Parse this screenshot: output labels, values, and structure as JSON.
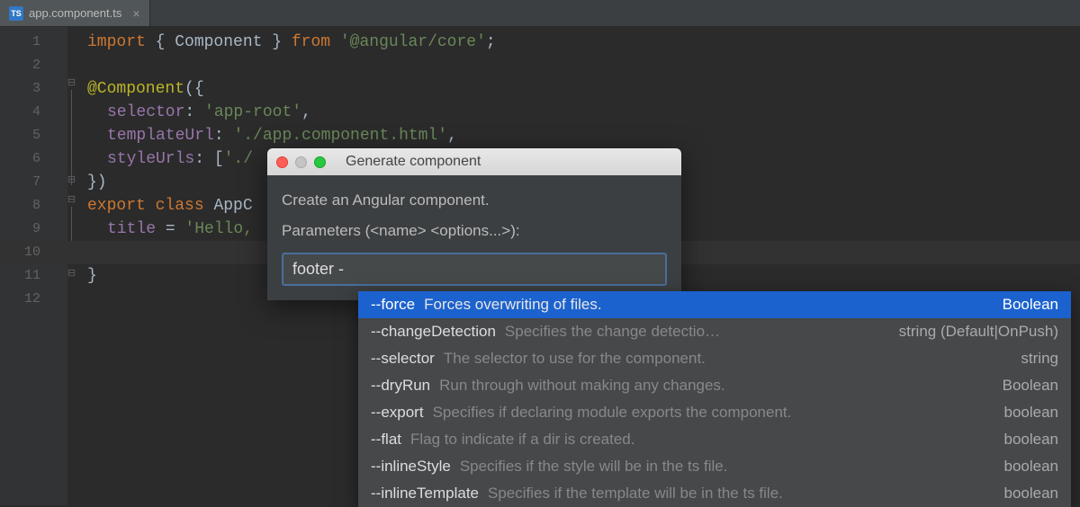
{
  "tab": {
    "file_icon_label": "TS",
    "filename": "app.component.ts",
    "close_glyph": "×"
  },
  "gutter": {
    "line_numbers": [
      "1",
      "2",
      "3",
      "4",
      "5",
      "6",
      "7",
      "8",
      "9",
      "10",
      "11",
      "12"
    ]
  },
  "code": {
    "l1_import": "import",
    "l1_braces_open": " { ",
    "l1_component": "Component",
    "l1_braces_close": " } ",
    "l1_from": "from",
    "l1_pkg": " '@angular/core'",
    "l1_semi": ";",
    "l3_decorator": "@Component",
    "l3_open": "({",
    "l4_key": "selector",
    "l4_colon": ": ",
    "l4_val": "'app-root'",
    "l4_comma": ",",
    "l5_key": "templateUrl",
    "l5_colon": ": ",
    "l5_val": "'./app.component.html'",
    "l5_comma": ",",
    "l6_key": "styleUrls",
    "l6_colon": ": [",
    "l6_val": "'./",
    "l7_close": "})",
    "l8_export": "export",
    "l8_class": " class ",
    "l8_name": "AppC",
    "l9_title": "title",
    "l9_eq": " = ",
    "l9_val": "'Hello,",
    "l11_brace": "}"
  },
  "dialog": {
    "title": "Generate component",
    "subtitle": "Create an Angular component.",
    "params_label": "Parameters (<name> <options...>):",
    "input_value": "footer -"
  },
  "autocomplete": {
    "rows": [
      {
        "flag": "--force",
        "desc": "Forces overwriting of files.",
        "type": "Boolean",
        "selected": true
      },
      {
        "flag": "--changeDetection",
        "desc": "Specifies the change detectio…",
        "type": "string (Default|OnPush)",
        "selected": false
      },
      {
        "flag": "--selector",
        "desc": "The selector to use for the component.",
        "type": "string",
        "selected": false
      },
      {
        "flag": "--dryRun",
        "desc": "Run through without making any changes.",
        "type": "Boolean",
        "selected": false
      },
      {
        "flag": "--export",
        "desc": "Specifies if declaring module exports the component.",
        "type": "boolean",
        "selected": false
      },
      {
        "flag": "--flat",
        "desc": "Flag to indicate if a dir is created.",
        "type": "boolean",
        "selected": false
      },
      {
        "flag": "--inlineStyle",
        "desc": "Specifies if the style will be in the ts file.",
        "type": "boolean",
        "selected": false
      },
      {
        "flag": "--inlineTemplate",
        "desc": "Specifies if the template will be in the ts file.",
        "type": "boolean",
        "selected": false
      }
    ]
  }
}
